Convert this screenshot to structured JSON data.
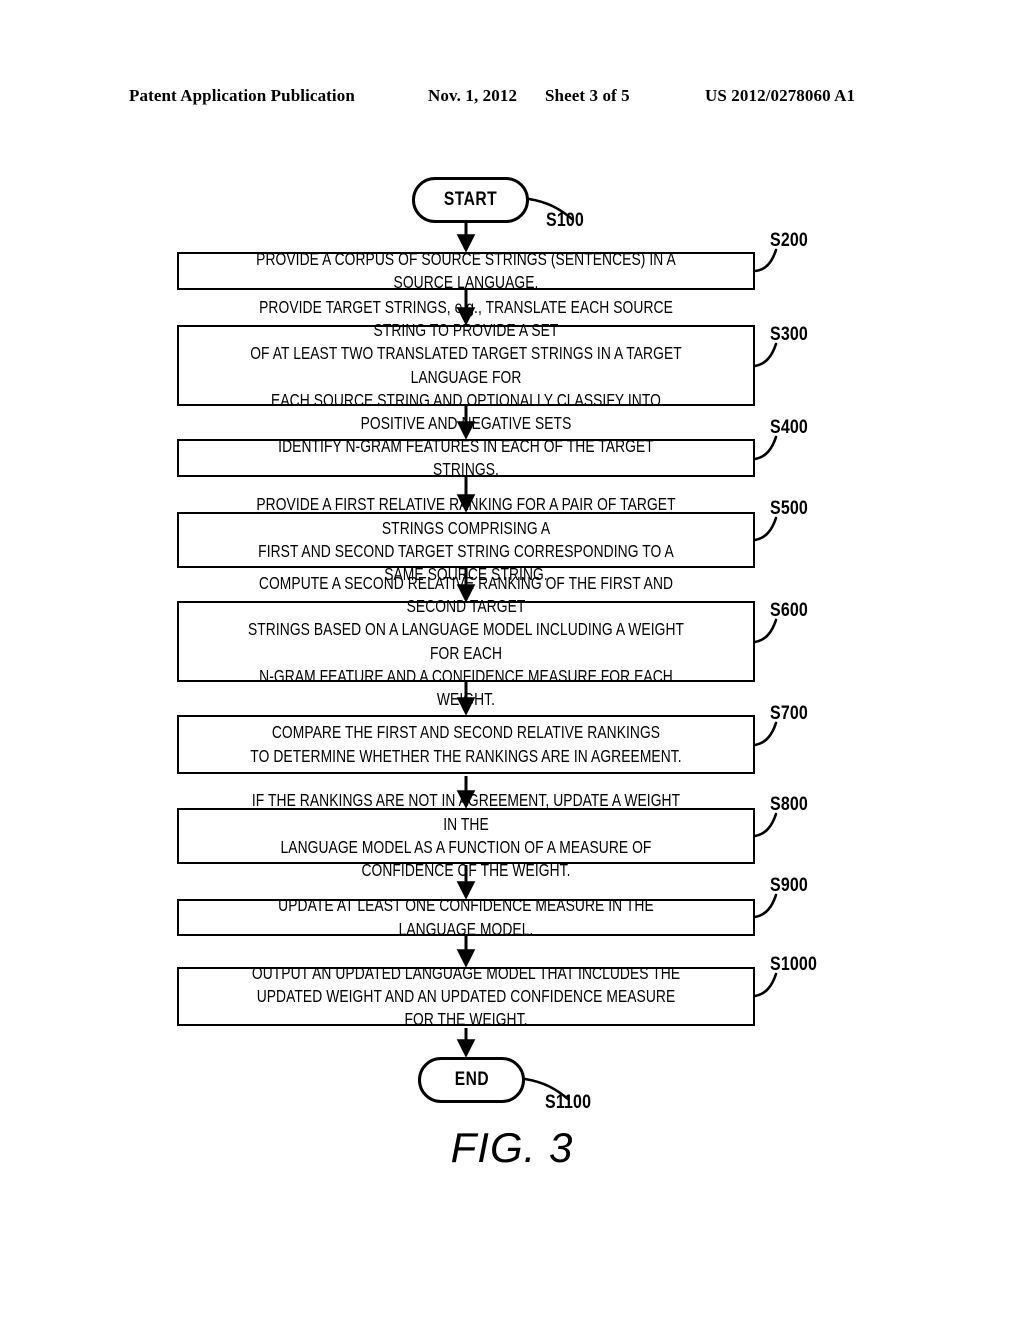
{
  "header": {
    "publication": "Patent Application Publication",
    "date": "Nov. 1, 2012",
    "sheet": "Sheet 3 of 5",
    "patent_number": "US 2012/0278060 A1"
  },
  "figure": {
    "caption": "FIG. 3",
    "type": "flowchart",
    "orientation": "top-to-bottom"
  },
  "flowchart": {
    "start": {
      "label": "START",
      "ref": "S100",
      "shape": "terminator"
    },
    "end": {
      "label": "END",
      "ref": "S1100",
      "shape": "terminator"
    },
    "steps": [
      {
        "ref": "S200",
        "shape": "process",
        "lines": [
          "PROVIDE A CORPUS OF SOURCE STRINGS (SENTENCES) IN A SOURCE LANGUAGE."
        ]
      },
      {
        "ref": "S300",
        "shape": "process",
        "lines": [
          "PROVIDE TARGET STRINGS, e.g., TRANSLATE EACH SOURCE STRING TO PROVIDE A SET",
          "OF AT LEAST TWO TRANSLATED TARGET STRINGS IN A TARGET LANGUAGE FOR",
          "EACH SOURCE STRING AND OPTIONALLY CLASSIFY INTO POSITIVE AND NEGATIVE SETS"
        ]
      },
      {
        "ref": "S400",
        "shape": "process",
        "lines": [
          "IDENTIFY N-GRAM FEATURES IN EACH OF THE TARGET STRINGS."
        ]
      },
      {
        "ref": "S500",
        "shape": "process",
        "lines": [
          "PROVIDE A FIRST RELATIVE RANKING FOR A PAIR OF TARGET STRINGS COMPRISING A",
          "FIRST AND  SECOND TARGET STRING CORRESPONDING TO A SAME SOURCE STRING."
        ]
      },
      {
        "ref": "S600",
        "shape": "process",
        "lines": [
          "COMPUTE A SECOND RELATIVE RANKING OF THE FIRST AND SECOND TARGET",
          "STRINGS BASED ON A LANGUAGE MODEL INCLUDING A WEIGHT FOR EACH",
          "N-GRAM FEATURE AND A CONFIDENCE MEASURE FOR EACH WEIGHT."
        ]
      },
      {
        "ref": "S700",
        "shape": "process",
        "lines": [
          "COMPARE THE FIRST AND SECOND RELATIVE RANKINGS",
          "TO DETERMINE WHETHER THE RANKINGS ARE IN AGREEMENT."
        ]
      },
      {
        "ref": "S800",
        "shape": "process",
        "lines": [
          "IF THE RANKINGS ARE NOT IN AGREEMENT, UPDATE A WEIGHT IN THE",
          "LANGUAGE MODEL AS A FUNCTION OF A MEASURE OF CONFIDENCE OF THE WEIGHT."
        ]
      },
      {
        "ref": "S900",
        "shape": "process",
        "lines": [
          "UPDATE AT LEAST ONE CONFIDENCE MEASURE IN THE LANGUAGE MODEL."
        ]
      },
      {
        "ref": "S1000",
        "shape": "process",
        "lines": [
          "OUTPUT AN UPDATED LANGUAGE MODEL THAT INCLUDES THE",
          "UPDATED WEIGHT AND AN UPDATED CONFIDENCE MEASURE FOR THE WEIGHT."
        ]
      }
    ]
  },
  "colors": {
    "ink": "#000000",
    "paper": "#ffffff"
  }
}
